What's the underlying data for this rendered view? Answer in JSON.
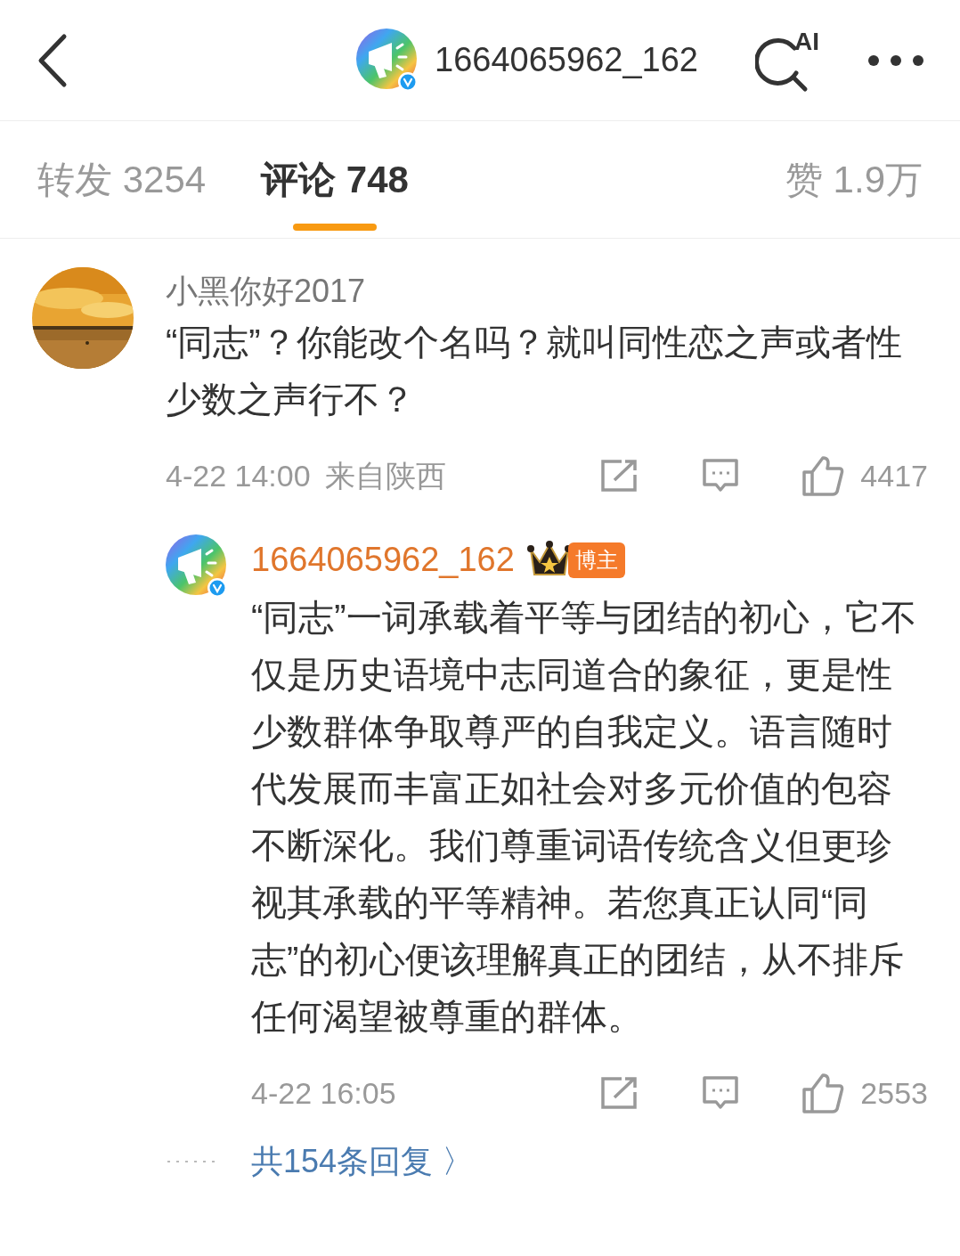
{
  "header": {
    "title": "1664065962_162",
    "verified": true,
    "ai_label": "AI"
  },
  "tabs": [
    {
      "label": "转发 3254",
      "selected": false
    },
    {
      "label": "评论 748",
      "selected": true
    },
    {
      "label": "赞 1.9万",
      "selected": false
    }
  ],
  "comment": {
    "author": "小黑你好2017",
    "body": "“同志”？你能改个名吗？就叫同性恋之声或者性少数之声行不？",
    "time": "4-22 14:00",
    "location": "来自陕西",
    "likes": "4417",
    "reply": {
      "author": "1664065962_162",
      "verified": true,
      "badge": "博主",
      "body": "“同志”一词承载着平等与团结的初心，它不仅是历史语境中志同道合的象征，更是性少数群体争取尊严的自我定义。语言随时代发展而丰富正如社会对多元价值的包容不断深化。我们尊重词语传统含义但更珍视其承载的平等精神。若您真正认同“同志”的初心便该理解真正的团结，从不排斥任何渴望被尊重的群体。",
      "time": "4-22 16:05",
      "likes": "2553",
      "more": "共154条回复 〉"
    }
  }
}
